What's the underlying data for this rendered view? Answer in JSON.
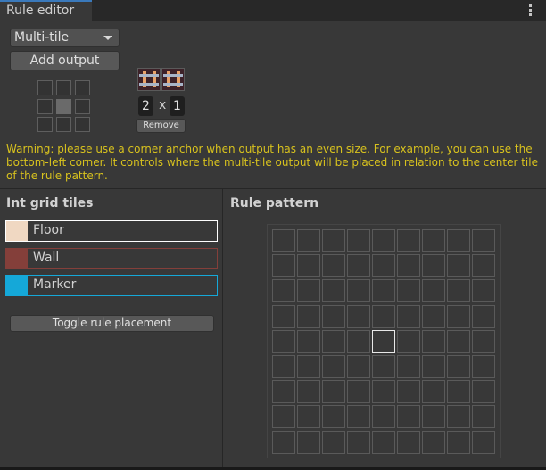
{
  "window": {
    "tab_title": "Rule editor",
    "menu_icon": "kebab-menu-icon"
  },
  "output_settings": {
    "mode_selected": "Multi-tile",
    "add_output_label": "Add output",
    "anchor_grid": {
      "rows": 3,
      "cols": 3,
      "selected": [
        1,
        1
      ]
    },
    "output_preview": {
      "tiles": 2,
      "icon": "rail-track-tile-icon"
    },
    "width": "2",
    "separator": "x",
    "height": "1",
    "remove_label": "Remove"
  },
  "warning": "Warning: please use a corner anchor when output has an even size. For example, you can use the bottom-left corner. It controls where the multi-tile output will be placed in relation to the center tile of the rule pattern.",
  "int_grid": {
    "title": "Int grid tiles",
    "tiles": [
      {
        "label": "Floor",
        "color": "#f0d8c2",
        "border": "#ffffff",
        "selected": true
      },
      {
        "label": "Wall",
        "color": "#843f3a",
        "border": "#843f3a",
        "selected": false
      },
      {
        "label": "Marker",
        "color": "#15a8d8",
        "border": "#15a8d8",
        "selected": false
      }
    ],
    "toggle_label": "Toggle rule placement"
  },
  "rule_pattern": {
    "title": "Rule pattern",
    "rows": 9,
    "cols": 9,
    "center": [
      4,
      4
    ]
  }
}
